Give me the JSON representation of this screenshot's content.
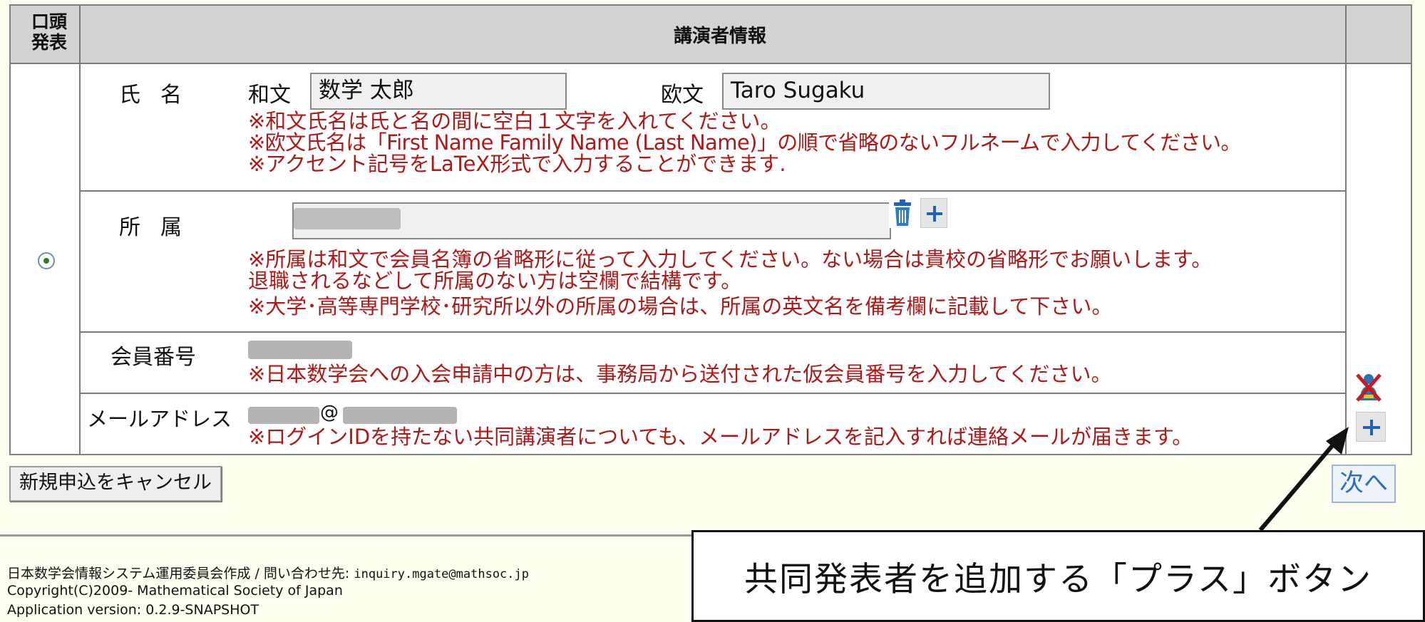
{
  "table": {
    "header_oral": "口頭\n発表",
    "header_title": "講演者情報"
  },
  "name": {
    "label": "氏名",
    "ja_label": "和文",
    "ja_value": "数学 太郎",
    "en_label": "欧文",
    "en_value": "Taro Sugaku",
    "notes": [
      "※和文氏名は氏と名の間に空白１文字を入れてください。",
      "※欧文氏名は「First Name Family Name (Last Name)」の順で省略のないフルネームで入力してください。",
      "※アクセント記号をLaTeX形式で入力することができます."
    ]
  },
  "affiliation": {
    "label": "所属",
    "notes": [
      "※所属は和文で会員名簿の省略形に従って入力してください。ない場合は貴校の省略形でお願いします。",
      "退職されるなどして所属のない方は空欄で結構です。",
      "※大学･高等専門学校･研究所以外の所属の場合は、所属の英文名を備考欄に記載して下さい。"
    ]
  },
  "member": {
    "label": "会員番号",
    "note": "※日本数学会への入会申請中の方は、事務局から送付された仮会員番号を入力してください。"
  },
  "email": {
    "label": "メールアドレス",
    "at": "@",
    "note": "※ログインIDを持たない共同講演者についても、メールアドレスを記入すれば連絡メールが届きます。"
  },
  "buttons": {
    "cancel": "新規申込をキャンセル",
    "next": "次へ"
  },
  "footer": {
    "line1": "日本数学会情報システム運用委員会作成 / 問い合わせ先: ",
    "line1_email": "inquiry.mgate@mathsoc.jp",
    "line2": "Copyright(C)2009- Mathematical Society of Japan",
    "line3": "Application version: 0.2.9-SNAPSHOT"
  },
  "callout": {
    "text": "共同発表者を追加する「プラス」ボタン"
  },
  "icons": {
    "trash": "trash-icon",
    "plus": "plus-icon",
    "delete_person": "delete-person-icon"
  },
  "colors": {
    "header_bg": "#d3d3d3",
    "note_text": "#b01818",
    "accent_blue": "#1d63b9",
    "page_bg": "#fffff0"
  }
}
